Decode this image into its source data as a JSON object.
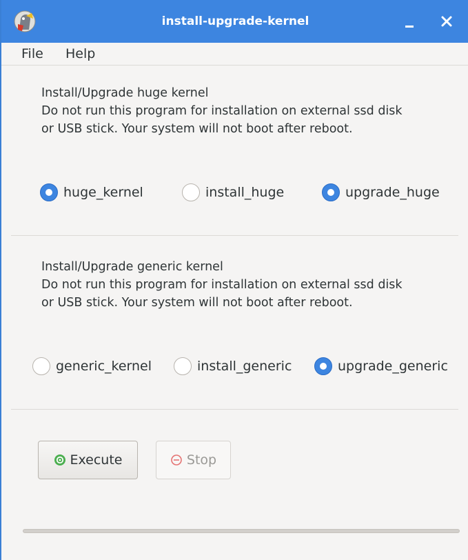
{
  "window": {
    "title": "install-upgrade-kernel"
  },
  "menu": {
    "items": [
      {
        "label": "File"
      },
      {
        "label": "Help"
      }
    ]
  },
  "huge_section": {
    "heading": "Install/Upgrade huge kernel",
    "warning_line1": "Do not run this program for installation on external ssd disk",
    "warning_line2": "or USB stick. Your system will not boot after reboot.",
    "options": [
      {
        "label": "huge_kernel",
        "selected": true
      },
      {
        "label": "install_huge",
        "selected": false
      },
      {
        "label": "upgrade_huge",
        "selected": true
      }
    ]
  },
  "generic_section": {
    "heading": "Install/Upgrade generic kernel",
    "warning_line1": "Do not run this program for installation on external ssd disk",
    "warning_line2": "or USB stick. Your system will not boot after reboot.",
    "options": [
      {
        "label": "generic_kernel",
        "selected": false
      },
      {
        "label": "install_generic",
        "selected": false
      },
      {
        "label": "upgrade_generic",
        "selected": true
      }
    ]
  },
  "buttons": {
    "execute_label": "Execute",
    "execute_icon": "execute-gear-icon",
    "stop_label": "Stop",
    "stop_icon": "stop-icon"
  },
  "progress": {
    "fraction": 0
  },
  "colors": {
    "accent": "#3d85e0",
    "execute_icon": "#4caf50",
    "stop_icon": "#e57373"
  }
}
